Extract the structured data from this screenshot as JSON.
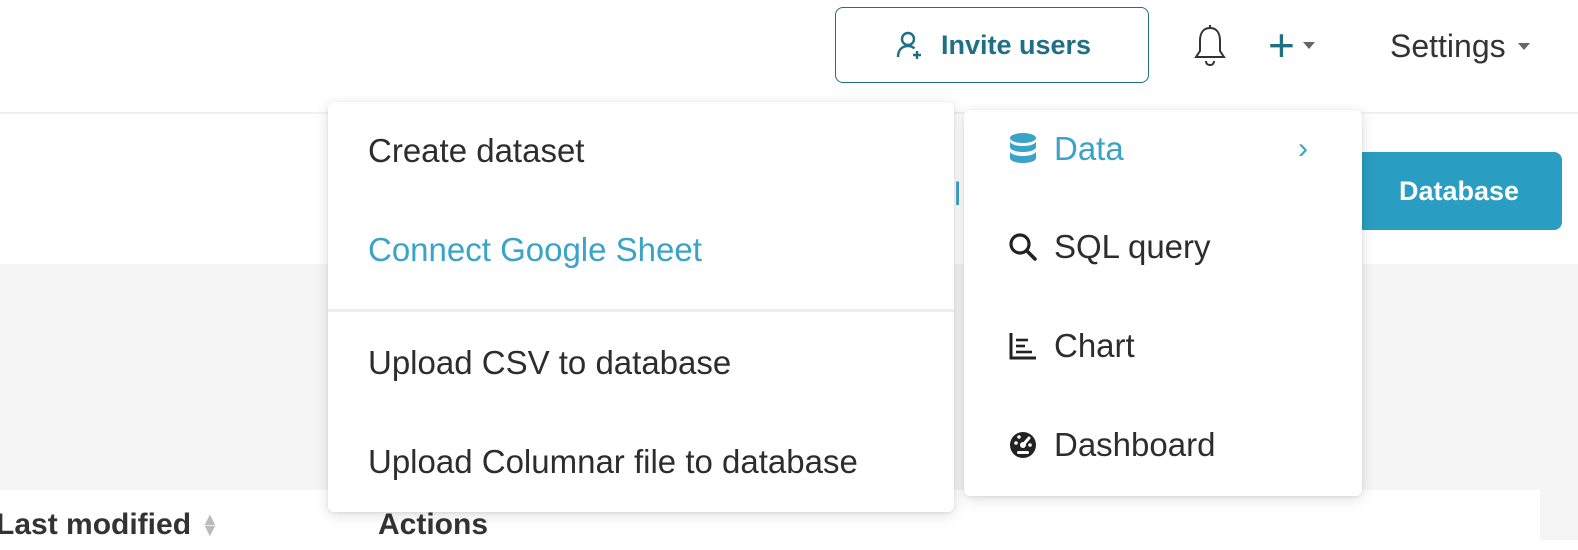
{
  "header": {
    "invite_label": "Invite users",
    "plus_glyph": "+",
    "settings_label": "Settings"
  },
  "page": {
    "database_button_label": "Database",
    "partial_text": "l"
  },
  "table": {
    "columns": [
      "Last modified",
      "Actions"
    ]
  },
  "menu_left": {
    "items": [
      {
        "label": "Create dataset"
      },
      {
        "label": "Connect Google Sheet"
      },
      {
        "label": "Upload CSV to database"
      },
      {
        "label": "Upload Columnar file to database"
      }
    ]
  },
  "menu_right": {
    "items": [
      {
        "label": "Data",
        "icon": "database-icon",
        "active": true
      },
      {
        "label": "SQL query",
        "icon": "search-icon"
      },
      {
        "label": "Chart",
        "icon": "chart-icon"
      },
      {
        "label": "Dashboard",
        "icon": "dashboard-icon"
      }
    ],
    "chevron_glyph": "›"
  },
  "colors": {
    "accent": "#3aa3c9",
    "primary_dark": "#1f6f86",
    "database_button": "#2a9dc2",
    "page_gray": "#f5f5f5"
  }
}
